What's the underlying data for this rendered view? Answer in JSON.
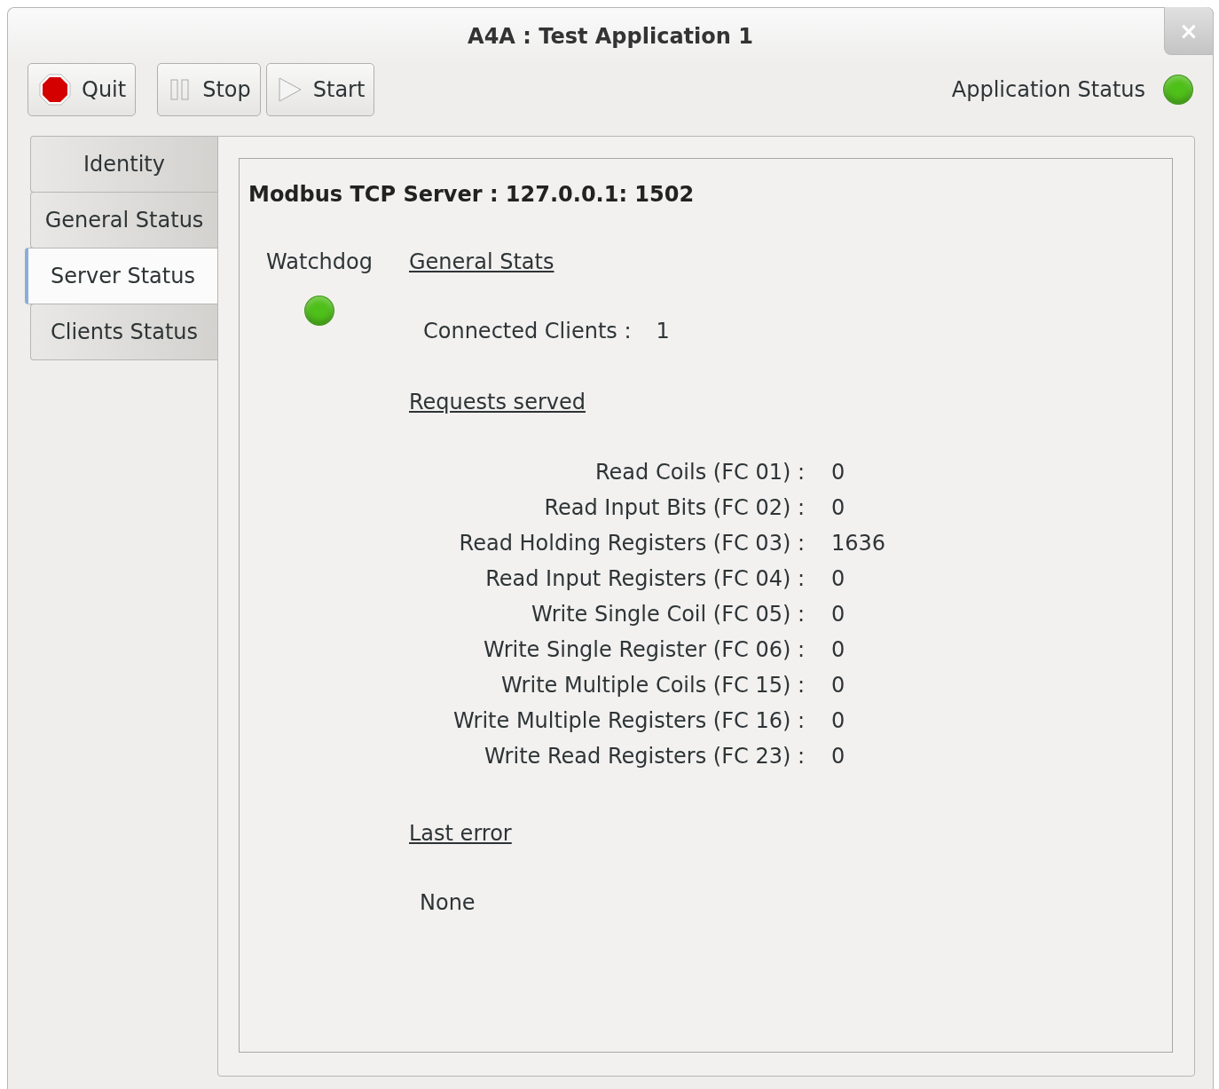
{
  "window": {
    "title": "A4A : Test Application 1",
    "close": "×"
  },
  "toolbar": {
    "buttons": [
      {
        "kind": "quit",
        "label": "Quit"
      },
      {
        "kind": "stop",
        "label": "Stop"
      },
      {
        "kind": "start",
        "label": "Start"
      }
    ],
    "status": {
      "label": "Application Status",
      "color": "#4fbf1a"
    }
  },
  "tabs": [
    {
      "label": "Identity",
      "selected": false
    },
    {
      "label": "General Status",
      "selected": false
    },
    {
      "label": "Server Status",
      "selected": true
    },
    {
      "label": "Clients Status",
      "selected": false
    }
  ],
  "server": {
    "title": "Modbus TCP Server : 127.0.0.1: 1502",
    "watchdog": {
      "label": "Watchdog",
      "color": "#4fbf1a"
    },
    "general_stats": {
      "heading": "General Stats",
      "label": "Connected Clients :",
      "value": "1"
    },
    "requests": {
      "heading": "Requests served",
      "rows": [
        {
          "label": "Read Coils (FC 01) :",
          "value": "0"
        },
        {
          "label": "Read Input Bits (FC 02) :",
          "value": "0"
        },
        {
          "label": "Read Holding Registers (FC 03) :",
          "value": "1636"
        },
        {
          "label": "Read Input Registers (FC 04) :",
          "value": "0"
        },
        {
          "label": "Write Single Coil (FC 05) :",
          "value": "0"
        },
        {
          "label": "Write Single Register (FC 06) :",
          "value": "0"
        },
        {
          "label": "Write Multiple Coils (FC 15) :",
          "value": "0"
        },
        {
          "label": "Write Multiple Registers (FC 16) :",
          "value": "0"
        },
        {
          "label": "Write Read Registers (FC 23) :",
          "value": "0"
        }
      ]
    },
    "last_error": {
      "heading": "Last error",
      "value": "None"
    }
  }
}
